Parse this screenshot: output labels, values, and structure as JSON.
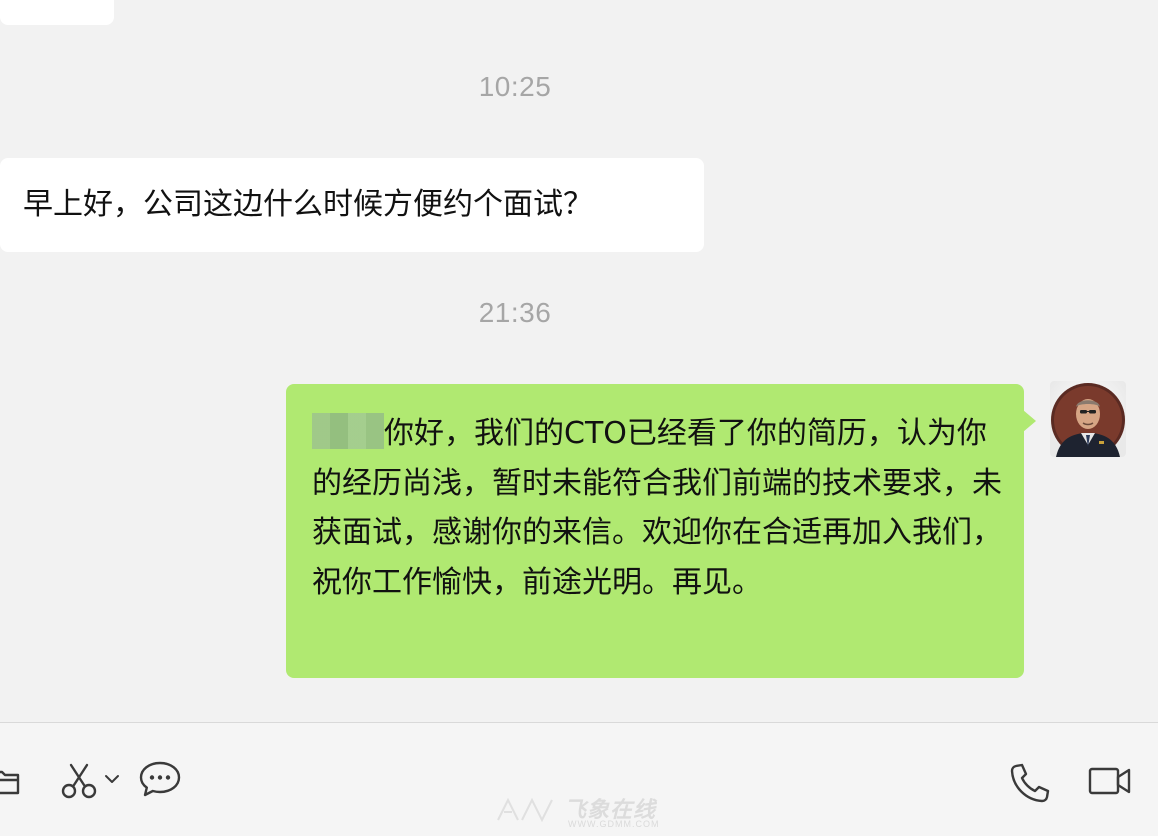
{
  "chat": {
    "timestamps": [
      "10:25",
      "21:36"
    ],
    "incoming_message": "早上好，公司这边什么时候方便约个面试？",
    "outgoing_message": "你好，我们的CTO已经看了你的简历，认为你的经历尚浅，暂时未能符合我们前端的技术要求，未获面试，感谢你的来信。欢迎你在合适再加入我们，祝你工作愉快，前途光明。再见。"
  },
  "colors": {
    "background": "#f2f2f2",
    "incoming_bubble": "#ffffff",
    "outgoing_bubble": "#b0e971",
    "timestamp_text": "#a6a6a6"
  },
  "toolbar": {
    "icons": [
      "folder-icon",
      "scissors-icon",
      "chevron-down-icon",
      "chat-bubble-icon",
      "phone-icon",
      "video-camera-icon"
    ]
  },
  "watermark": {
    "brand": "飞象在线",
    "url": "WWW.GDMM.COM"
  }
}
